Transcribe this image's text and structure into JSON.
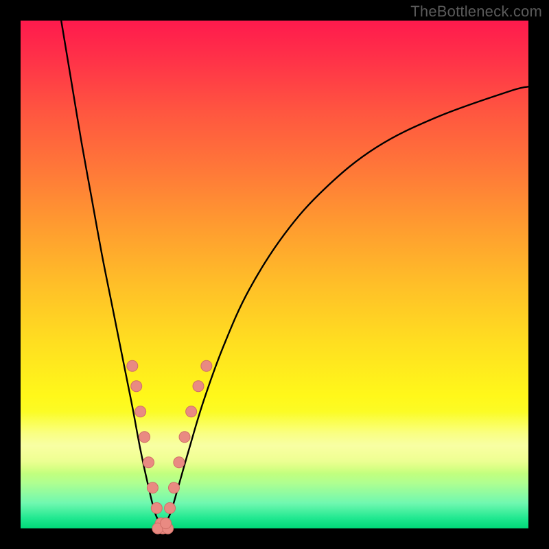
{
  "watermark": "TheBottleneck.com",
  "colors": {
    "black": "#000000",
    "curve": "#000000",
    "marker_fill": "#e98a82",
    "marker_stroke": "#cf6f67"
  },
  "chart_data": {
    "type": "line",
    "title": "",
    "xlabel": "",
    "ylabel": "",
    "xlim": [
      0,
      100
    ],
    "ylim": [
      0,
      100
    ],
    "grid": false,
    "legend": false,
    "notes": "Bottleneck-style V curve; y is bottleneck percentage (0 at the notch). Background is a vertical spectral gradient from red (top) to green (bottom). Markers cluster along both curve arms near the bottom.",
    "series": [
      {
        "name": "left-arm",
        "x": [
          8,
          10,
          12,
          14,
          16,
          18,
          20,
          22,
          23.5,
          25,
          26.5,
          28
        ],
        "y": [
          100,
          88,
          76,
          65,
          54,
          44,
          34,
          24,
          16,
          9,
          3,
          0
        ]
      },
      {
        "name": "right-arm",
        "x": [
          28,
          29.5,
          31,
          33,
          36,
          40,
          45,
          52,
          60,
          70,
          82,
          96,
          100
        ],
        "y": [
          0,
          3,
          8,
          15,
          25,
          36,
          47,
          58,
          67,
          75,
          81,
          86,
          87
        ]
      }
    ],
    "markers": {
      "name": "data-points",
      "points": [
        {
          "x": 22.0,
          "y": 32
        },
        {
          "x": 22.8,
          "y": 28
        },
        {
          "x": 23.6,
          "y": 23
        },
        {
          "x": 24.4,
          "y": 18
        },
        {
          "x": 25.2,
          "y": 13
        },
        {
          "x": 26.0,
          "y": 8
        },
        {
          "x": 26.8,
          "y": 4
        },
        {
          "x": 27.6,
          "y": 1
        },
        {
          "x": 28.0,
          "y": 0
        },
        {
          "x": 27.0,
          "y": 0
        },
        {
          "x": 29.0,
          "y": 0
        },
        {
          "x": 28.6,
          "y": 1
        },
        {
          "x": 29.4,
          "y": 4
        },
        {
          "x": 30.2,
          "y": 8
        },
        {
          "x": 31.2,
          "y": 13
        },
        {
          "x": 32.3,
          "y": 18
        },
        {
          "x": 33.6,
          "y": 23
        },
        {
          "x": 35.0,
          "y": 28
        },
        {
          "x": 36.6,
          "y": 32
        }
      ]
    }
  }
}
